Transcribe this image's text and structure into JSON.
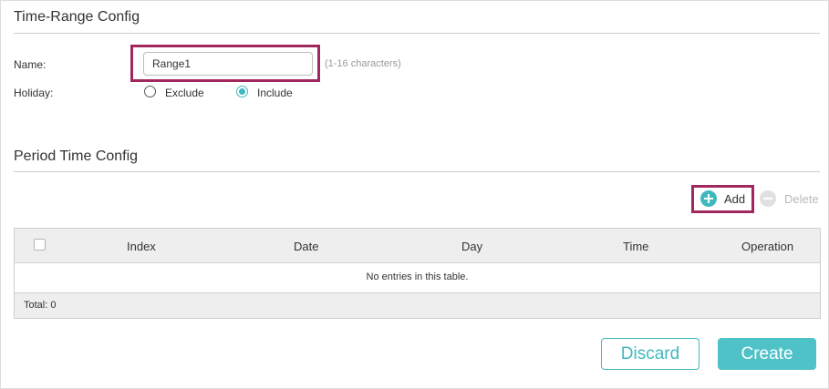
{
  "time_range": {
    "title": "Time-Range Config",
    "name_label": "Name:",
    "name_value": "Range1",
    "name_hint": "(1-16 characters)",
    "holiday_label": "Holiday:",
    "holiday_options": [
      {
        "label": "Exclude",
        "checked": false
      },
      {
        "label": "Include",
        "checked": true
      }
    ]
  },
  "period": {
    "title": "Period Time Config",
    "add_label": "Add",
    "delete_label": "Delete",
    "columns": [
      "Index",
      "Date",
      "Day",
      "Time",
      "Operation"
    ],
    "empty_message": "No entries in this table.",
    "total_label": "Total: 0"
  },
  "actions": {
    "discard_label": "Discard",
    "create_label": "Create"
  },
  "colors": {
    "accent": "#3fb8be",
    "highlight": "#a1285f",
    "disabled": "#b8b8b8"
  }
}
